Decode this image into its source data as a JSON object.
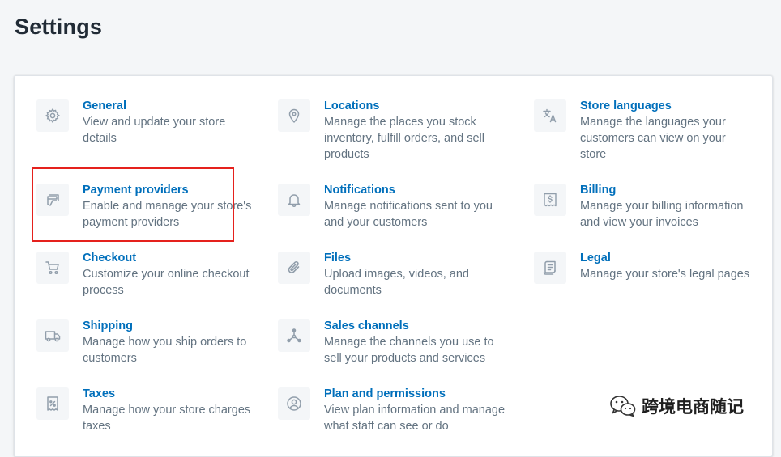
{
  "page": {
    "title": "Settings"
  },
  "colors": {
    "link": "#006fbb",
    "muted": "#637381",
    "icon": "#919eab",
    "highlight": "#e5211d"
  },
  "settings": [
    {
      "id": "general",
      "icon": "gear-icon",
      "title": "General",
      "desc": "View and update your store details"
    },
    {
      "id": "locations",
      "icon": "location-pin-icon",
      "title": "Locations",
      "desc": "Manage the places you stock inventory, fulfill orders, and sell products"
    },
    {
      "id": "store-languages",
      "icon": "translate-icon",
      "title": "Store languages",
      "desc": "Manage the languages your customers can view on your store"
    },
    {
      "id": "payment-providers",
      "icon": "payment-card-icon",
      "title": "Payment providers",
      "desc": "Enable and manage your store's payment providers"
    },
    {
      "id": "notifications",
      "icon": "bell-icon",
      "title": "Notifications",
      "desc": "Manage notifications sent to you and your customers"
    },
    {
      "id": "billing",
      "icon": "billing-icon",
      "title": "Billing",
      "desc": "Manage your billing information and view your invoices"
    },
    {
      "id": "checkout",
      "icon": "cart-icon",
      "title": "Checkout",
      "desc": "Customize your online checkout process"
    },
    {
      "id": "files",
      "icon": "paperclip-icon",
      "title": "Files",
      "desc": "Upload images, videos, and documents"
    },
    {
      "id": "legal",
      "icon": "legal-document-icon",
      "title": "Legal",
      "desc": "Manage your store's legal pages"
    },
    {
      "id": "shipping",
      "icon": "truck-icon",
      "title": "Shipping",
      "desc": "Manage how you ship orders to customers"
    },
    {
      "id": "sales-channels",
      "icon": "channels-icon",
      "title": "Sales channels",
      "desc": "Manage the channels you use to sell your products and services"
    },
    {
      "id": "taxes",
      "icon": "tax-receipt-icon",
      "title": "Taxes",
      "desc": "Manage how your store charges taxes"
    },
    {
      "id": "plan-permissions",
      "icon": "user-circle-icon",
      "title": "Plan and permissions",
      "desc": "View plan information and manage what staff can see or do"
    }
  ],
  "watermark": {
    "text": "跨境电商随记"
  }
}
